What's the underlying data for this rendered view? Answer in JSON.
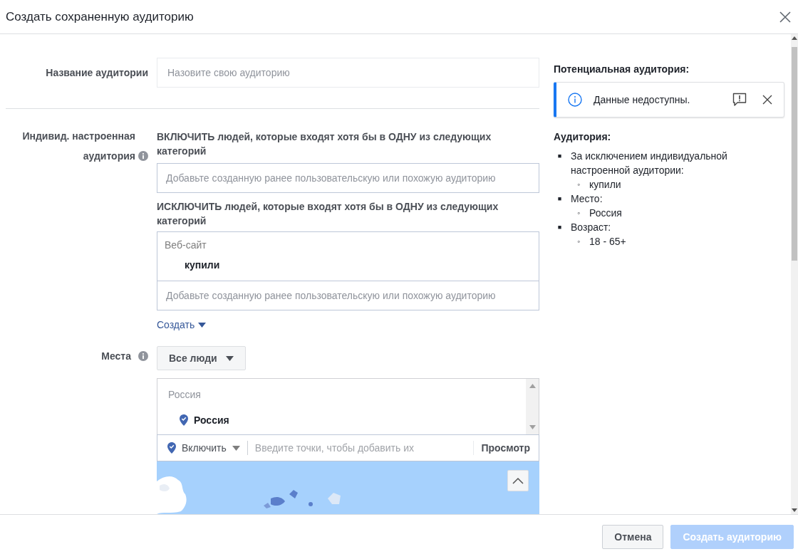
{
  "dialog": {
    "title": "Создать сохраненную аудиторию"
  },
  "form": {
    "name_field": {
      "label": "Название аудитории",
      "placeholder": "Назовите свою аудиторию"
    },
    "custom_audience": {
      "label": "Индивид. настроенная аудитория",
      "include_heading": "ВКЛЮЧИТЬ людей, которые входят хотя бы в ОДНУ из следующих категорий",
      "include_placeholder": "Добавьте созданную ранее пользовательскую или похожую аудиторию",
      "exclude_heading": "ИСКЛЮЧИТЬ людей, которые входят хотя бы в ОДНУ из следующих категорий",
      "excluded_group": {
        "type": "Веб-сайт",
        "items": [
          "купили"
        ]
      },
      "exclude_placeholder": "Добавьте созданную ранее пользовательскую или похожую аудиторию",
      "create_link": "Создать"
    },
    "locations": {
      "label": "Места",
      "audience_dropdown": "Все люди",
      "group_header": "Россия",
      "selected": [
        {
          "name": "Россия"
        }
      ],
      "mode": "Включить",
      "placeholder": "Введите точки, чтобы добавить их",
      "browse": "Просмотр"
    }
  },
  "sidebar": {
    "potential_title": "Потенциальная аудитория:",
    "notice": "Данные недоступны.",
    "audience_title": "Аудитория:",
    "summary": [
      {
        "marker": "■",
        "text": "За исключением индивидуальной настроенной аудитории:",
        "children": [
          {
            "marker": "◦",
            "text": "купили"
          }
        ]
      },
      {
        "marker": "■",
        "text": "Место:",
        "children": [
          {
            "marker": "◦",
            "text": "Россия"
          }
        ]
      },
      {
        "marker": "■",
        "text": "Возраст:",
        "children": [
          {
            "marker": "◦",
            "text": "18 - 65+"
          }
        ]
      }
    ]
  },
  "footer": {
    "buttons": [
      {
        "label": "Отмена",
        "kind": "secondary",
        "disabled": false
      },
      {
        "label": "Создать аудиторию",
        "kind": "primary",
        "disabled": true
      }
    ]
  }
}
